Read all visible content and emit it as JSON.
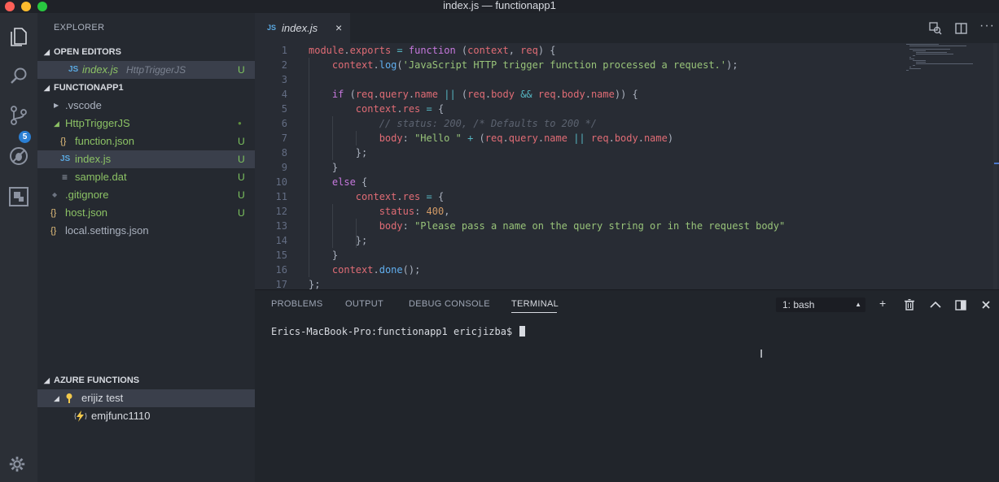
{
  "window": {
    "title": "index.js — functionapp1"
  },
  "activity_bar": {
    "items": [
      "explorer-icon",
      "search-icon",
      "source-control-icon",
      "debug-icon",
      "extensions-icon"
    ],
    "scm_badge": "5",
    "settings": "gear-icon"
  },
  "sidebar": {
    "title": "EXPLORER",
    "open_editors": {
      "header": "OPEN EDITORS",
      "items": [
        {
          "icon": "JS",
          "name": "index.js",
          "path": "HttpTriggerJS",
          "status": "U"
        }
      ]
    },
    "project": {
      "header": "FUNCTIONAPP1",
      "items": [
        {
          "name": ".vscode",
          "status": ""
        },
        {
          "name": "HttpTriggerJS",
          "status": "●"
        },
        {
          "name": "function.json",
          "icon": "{}",
          "status": "U"
        },
        {
          "name": "index.js",
          "icon": "JS",
          "status": "U"
        },
        {
          "name": "sample.dat",
          "icon": "≡",
          "status": "U"
        },
        {
          "name": ".gitignore",
          "icon": "◆",
          "status": "U"
        },
        {
          "name": "host.json",
          "icon": "{}",
          "status": "U"
        },
        {
          "name": "local.settings.json",
          "icon": "{}",
          "status": ""
        }
      ]
    },
    "azure": {
      "header": "AZURE FUNCTIONS",
      "subscription": "erijiz test",
      "function_app": "emjfunc1110"
    }
  },
  "editor": {
    "tab": {
      "icon": "JS",
      "name": "index.js",
      "close": "×"
    },
    "line_numbers": [
      "1",
      "2",
      "3",
      "4",
      "5",
      "6",
      "7",
      "8",
      "9",
      "10",
      "11",
      "12",
      "13",
      "14",
      "15",
      "16",
      "17"
    ],
    "code": [
      "module.exports = function (context, req) {",
      "    context.log('JavaScript HTTP trigger function processed a request.');",
      "",
      "    if (req.query.name || (req.body && req.body.name)) {",
      "        context.res = {",
      "            // status: 200, /* Defaults to 200 */",
      "            body: \"Hello \" + (req.query.name || req.body.name)",
      "        };",
      "    }",
      "    else {",
      "        context.res = {",
      "            status: 400,",
      "            body: \"Please pass a name on the query string or in the request body\"",
      "        };",
      "    }",
      "    context.done();",
      "};"
    ]
  },
  "panel": {
    "tabs": [
      "PROBLEMS",
      "OUTPUT",
      "DEBUG CONSOLE",
      "TERMINAL"
    ],
    "active_tab": "TERMINAL",
    "terminal_select": "1: bash",
    "prompt": "Erics-MacBook-Pro:functionapp1 ericjizba$ "
  },
  "colors": {
    "untracked": "#8cc265",
    "accent_badge": "#2a7fd4"
  }
}
